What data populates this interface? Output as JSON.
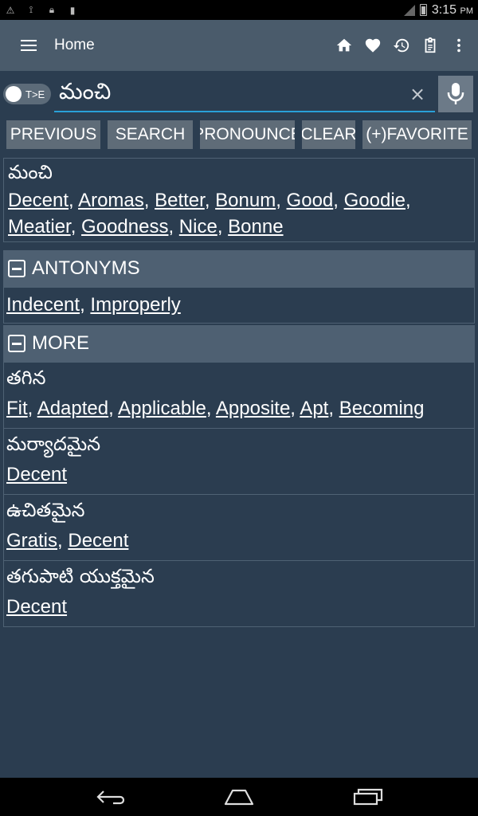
{
  "status_bar": {
    "time": "3:15",
    "ampm": "PM"
  },
  "app_bar": {
    "title": "Home"
  },
  "search": {
    "toggle_label": "T>E",
    "query": "మంచి",
    "clear_symbol": "×"
  },
  "buttons": {
    "previous": "PREVIOUS",
    "search": "SEARCH",
    "pronounce": "PRONOUNCE",
    "clear": "CLEAR",
    "favorite": "(+)FAVORITE"
  },
  "main_entry": {
    "word": "మంచి",
    "definitions": [
      "Decent",
      "Aromas",
      "Better",
      "Bonum",
      "Good",
      "Goodie",
      "Meatier",
      "Goodness",
      "Nice",
      "Bonne"
    ]
  },
  "antonyms": {
    "title": "ANTONYMS",
    "items": [
      "Indecent",
      "Improperly"
    ]
  },
  "more": {
    "title": "MORE",
    "items": [
      {
        "word": "తగిన",
        "definitions": [
          "Fit",
          "Adapted",
          "Applicable",
          "Apposite",
          "Apt",
          "Becoming"
        ]
      },
      {
        "word": "మర్యాదమైన",
        "definitions": [
          "Decent"
        ]
      },
      {
        "word": "ఉచితమైన",
        "definitions": [
          "Gratis",
          "Decent"
        ]
      },
      {
        "word": "తగుపాటి యుక్తమైన",
        "definitions": [
          "Decent"
        ]
      }
    ]
  },
  "colors": {
    "background": "#2b3d50",
    "app_bar": "#4a5b6b",
    "section_header": "#4e6072",
    "button": "#5f6c78",
    "accent": "#29a0d8"
  }
}
